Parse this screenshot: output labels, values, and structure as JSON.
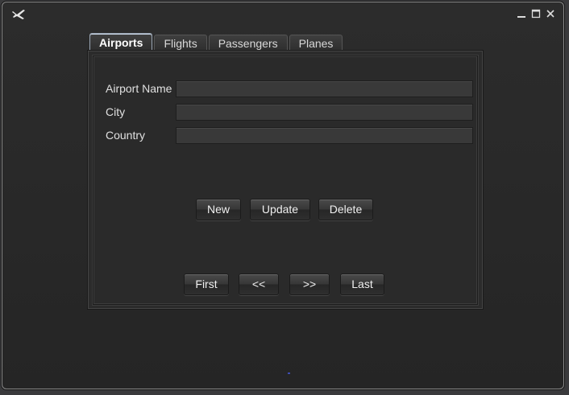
{
  "window": {
    "controls": [
      {
        "name": "minimize-icon",
        "glyph": "_"
      },
      {
        "name": "maximize-icon",
        "glyph": "□"
      },
      {
        "name": "close-icon",
        "glyph": "✕"
      }
    ]
  },
  "tabs": [
    {
      "label": "Airports",
      "active": true
    },
    {
      "label": "Flights",
      "active": false
    },
    {
      "label": "Passengers",
      "active": false
    },
    {
      "label": "Planes",
      "active": false
    }
  ],
  "form": {
    "fields": [
      {
        "label": "Airport Name",
        "value": ""
      },
      {
        "label": "City",
        "value": ""
      },
      {
        "label": "Country",
        "value": ""
      }
    ]
  },
  "actions": {
    "new_label": "New",
    "update_label": "Update",
    "delete_label": "Delete"
  },
  "navigation": {
    "first_label": "First",
    "prev_label": "<<",
    "next_label": ">>",
    "last_label": "Last"
  }
}
